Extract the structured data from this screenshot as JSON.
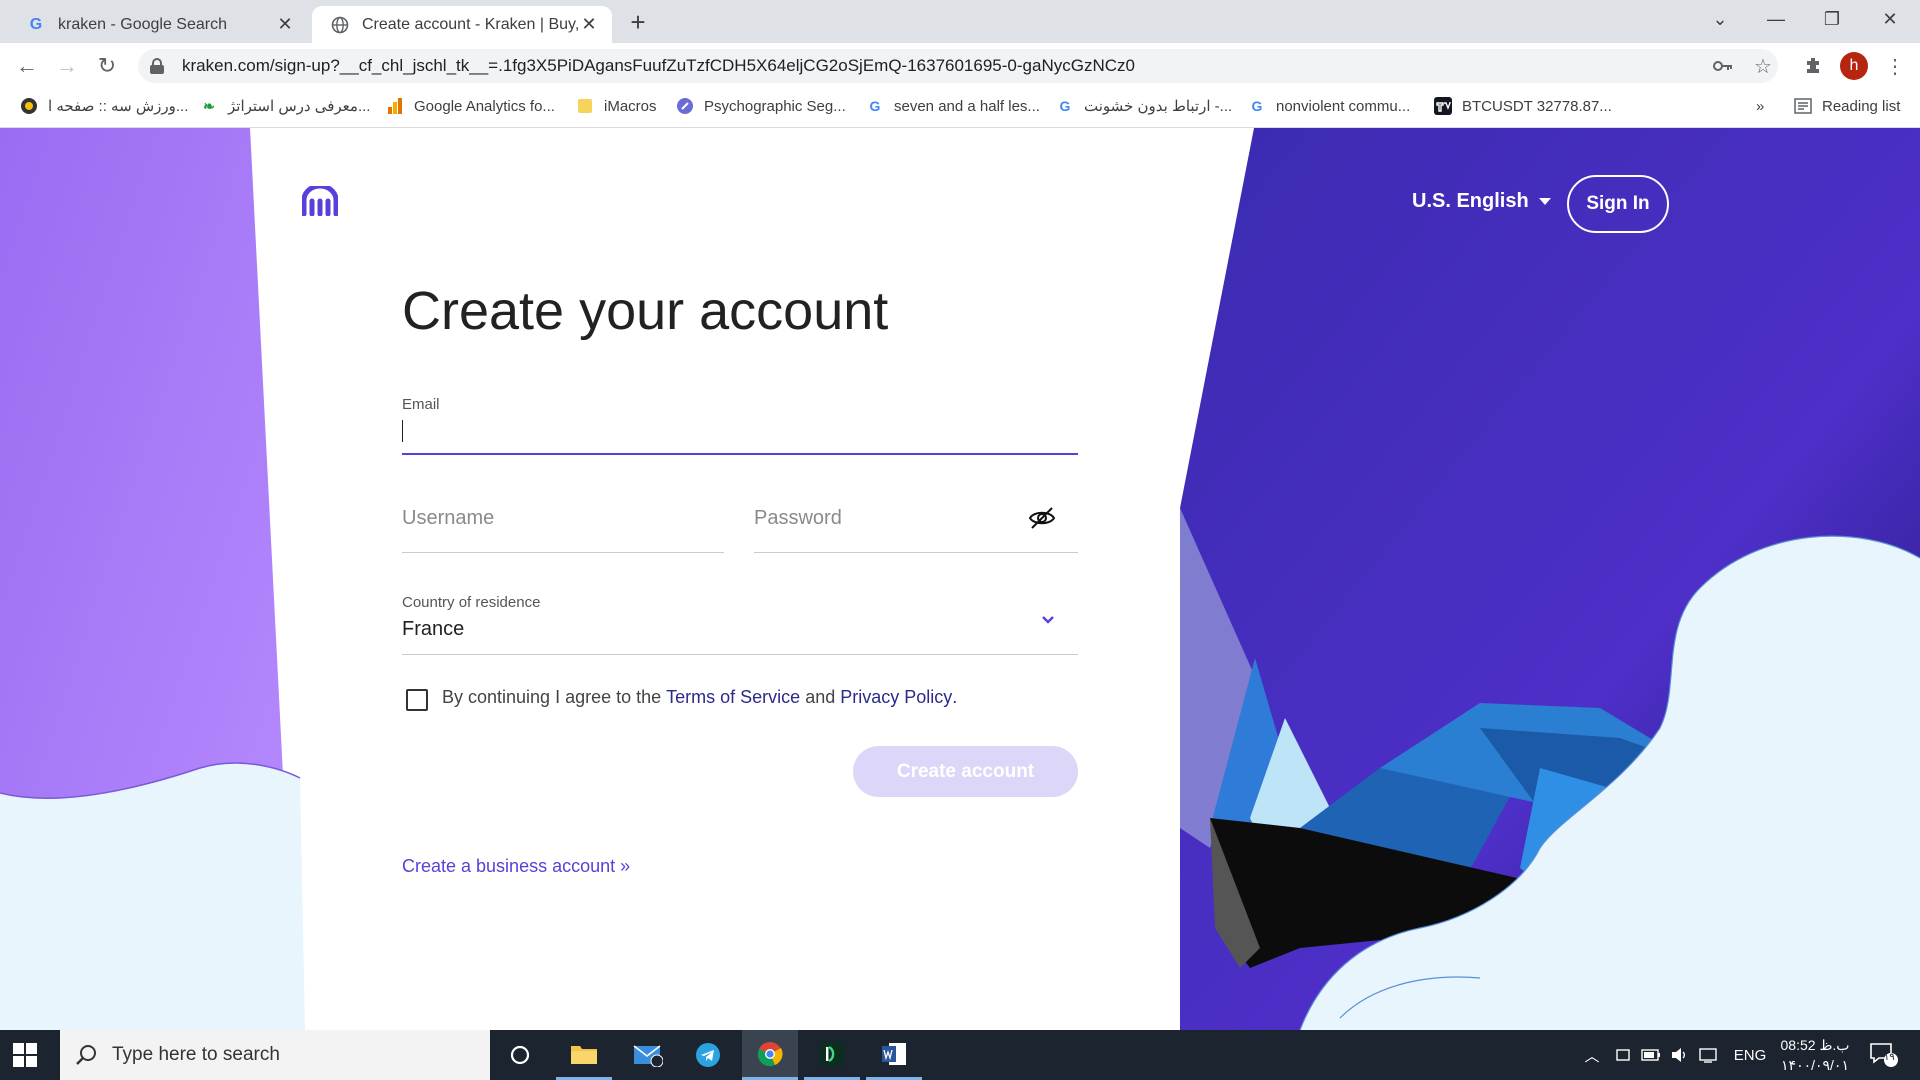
{
  "browser": {
    "tabs": [
      {
        "title": "kraken - Google Search",
        "favicon": "google-g-icon"
      },
      {
        "title": "Create account - Kraken | Buy, Se",
        "favicon": "globe-icon"
      }
    ],
    "url": "kraken.com/sign-up?__cf_chl_jschl_tk__=.1fg3X5PiDAgansFuufZuTzfCDH5X64eljCG2oSjEmQ-1637601695-0-gaNycGzNCz0",
    "profile_initial": "h",
    "bookmarks": [
      "ورزش سه :: صفحه ا...",
      "معرفی درس استراتژ...",
      "Google Analytics fo...",
      "iMacros",
      "Psychographic Seg...",
      "seven and a half les...",
      "ارتباط بدون خشونت -...",
      "nonviolent commu...",
      "BTCUSDT 32778.87..."
    ],
    "bookmarks_overflow": "»",
    "reading_list": "Reading list"
  },
  "page": {
    "language": "U.S. English",
    "sign_in": "Sign In",
    "title": "Create your account",
    "email_label": "Email",
    "username_placeholder": "Username",
    "password_placeholder": "Password",
    "country_label": "Country of residence",
    "country_value": "France",
    "agree_prefix": "By continuing I agree to the ",
    "terms": "Terms of Service",
    "agree_mid": " and ",
    "privacy": "Privacy Policy",
    "agree_suffix": ".",
    "create_button": "Create account",
    "business_link": "Create a business account »",
    "colors": {
      "brand_purple": "#5741d9",
      "button_disabled": "#dcd7f8",
      "link_dark": "#2a2a8a"
    }
  },
  "taskbar": {
    "search_placeholder": "Type here to search",
    "language": "ENG",
    "time": "08:52 ب.ظ",
    "date": "۱۴۰۰/۰۹/۰۱",
    "notification_count": "۱۹"
  }
}
